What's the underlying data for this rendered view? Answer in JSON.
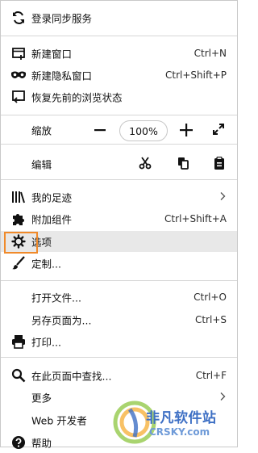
{
  "menu": {
    "sync": {
      "label": "登录同步服务",
      "icon": "sync-icon"
    },
    "new_window": {
      "label": "新建窗口",
      "shortcut": "Ctrl+N",
      "icon": "new-window-icon"
    },
    "private_window": {
      "label": "新建隐私窗口",
      "shortcut": "Ctrl+Shift+P",
      "icon": "private-mask-icon"
    },
    "restore_session": {
      "label": "恢复先前的浏览状态",
      "icon": "restore-icon"
    },
    "zoom": {
      "label": "缩放",
      "minus": "—",
      "value": "100%",
      "plus": "+",
      "fullscreen": "⤢"
    },
    "edit": {
      "label": "编辑"
    },
    "library": {
      "label": "我的足迹",
      "icon": "library-icon"
    },
    "addons": {
      "label": "附加组件",
      "shortcut": "Ctrl+Shift+A",
      "icon": "puzzle-icon"
    },
    "options": {
      "label": "选项",
      "icon": "gear-icon"
    },
    "customize": {
      "label": "定制...",
      "icon": "brush-icon"
    },
    "open_file": {
      "label": "打开文件...",
      "shortcut": "Ctrl+O"
    },
    "save_as": {
      "label": "另存页面为...",
      "shortcut": "Ctrl+S"
    },
    "print": {
      "label": "打印...",
      "icon": "printer-icon"
    },
    "find": {
      "label": "在此页面中查找...",
      "shortcut": "Ctrl+F",
      "icon": "search-icon"
    },
    "more": {
      "label": "更多"
    },
    "web_dev": {
      "label": "Web 开发者"
    },
    "help": {
      "label": "帮助",
      "icon": "help-icon"
    }
  },
  "watermark": {
    "title": "非凡软件站",
    "sub": "CRSKY.com"
  },
  "colors": {
    "highlight_border": "#f08a2a",
    "row_highlight": "#e8e8e8"
  }
}
